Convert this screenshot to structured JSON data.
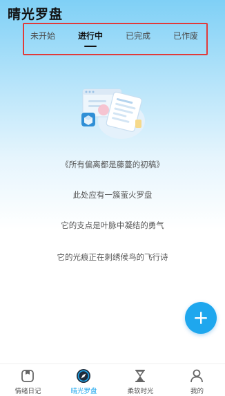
{
  "app": {
    "title": "晴光罗盘"
  },
  "tabs": [
    {
      "label": "未开始",
      "active": false
    },
    {
      "label": "进行中",
      "active": true
    },
    {
      "label": "已完成",
      "active": false
    },
    {
      "label": "已作废",
      "active": false
    }
  ],
  "empty_state": {
    "illustration_icon": "empty-document-illustration",
    "lines": [
      "《所有偏离都是藤蔓的初稿》",
      "此处应有一簇萤火罗盘",
      "它的支点是叶脉中凝结的勇气",
      "它的光痕正在刺绣候鸟的飞行诗"
    ]
  },
  "fab": {
    "icon": "plus-icon",
    "color": "#1ea7ee"
  },
  "bottom_nav": [
    {
      "label": "情绪日记",
      "icon": "diary-icon",
      "active": false
    },
    {
      "label": "晴光罗盘",
      "icon": "compass-icon",
      "active": true
    },
    {
      "label": "柔软时光",
      "icon": "hourglass-icon",
      "active": false
    },
    {
      "label": "我的",
      "icon": "user-icon",
      "active": false
    }
  ],
  "colors": {
    "accent": "#1ea7ee",
    "highlight_border": "#e03a3a"
  }
}
